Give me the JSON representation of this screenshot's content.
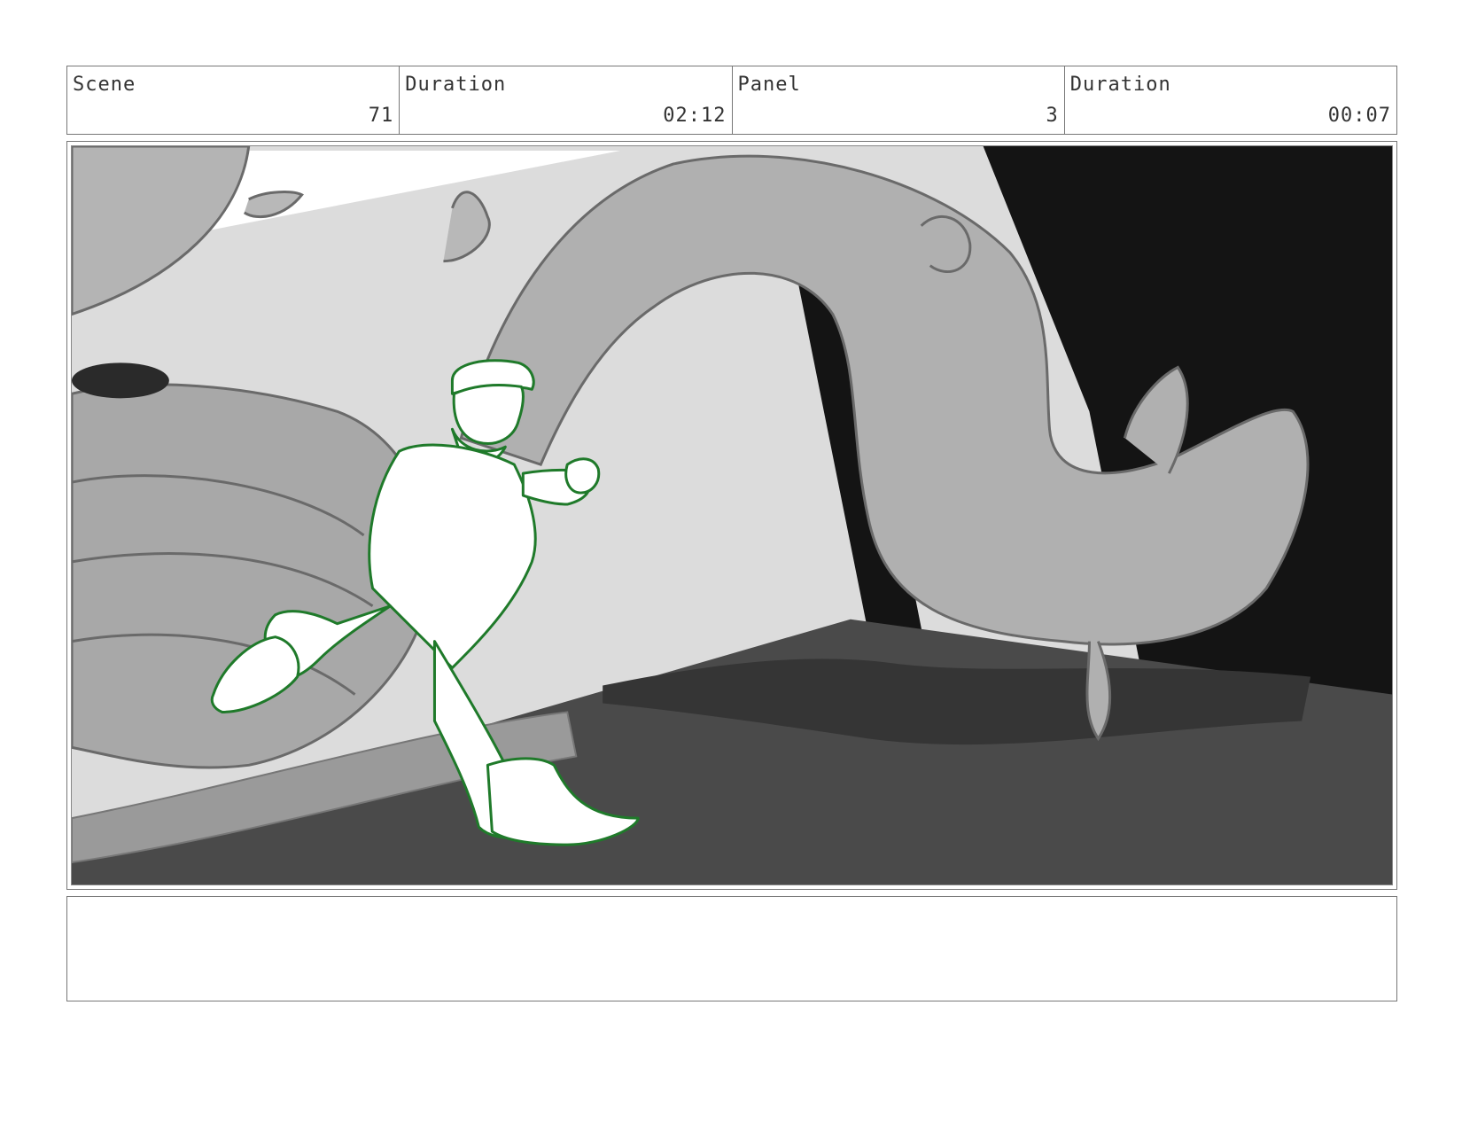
{
  "header": {
    "scene_label": "Scene",
    "scene_value": "71",
    "scene_duration_label": "Duration",
    "scene_duration_value": "02:12",
    "panel_label": "Panel",
    "panel_value": "3",
    "panel_duration_label": "Duration",
    "panel_duration_value": "00:07"
  },
  "notes": {
    "text": ""
  },
  "colors": {
    "character_line": "#1f7a2a",
    "plant": "#b0b0b0",
    "floor": "#4a4a4a",
    "shadow": "#141414"
  }
}
